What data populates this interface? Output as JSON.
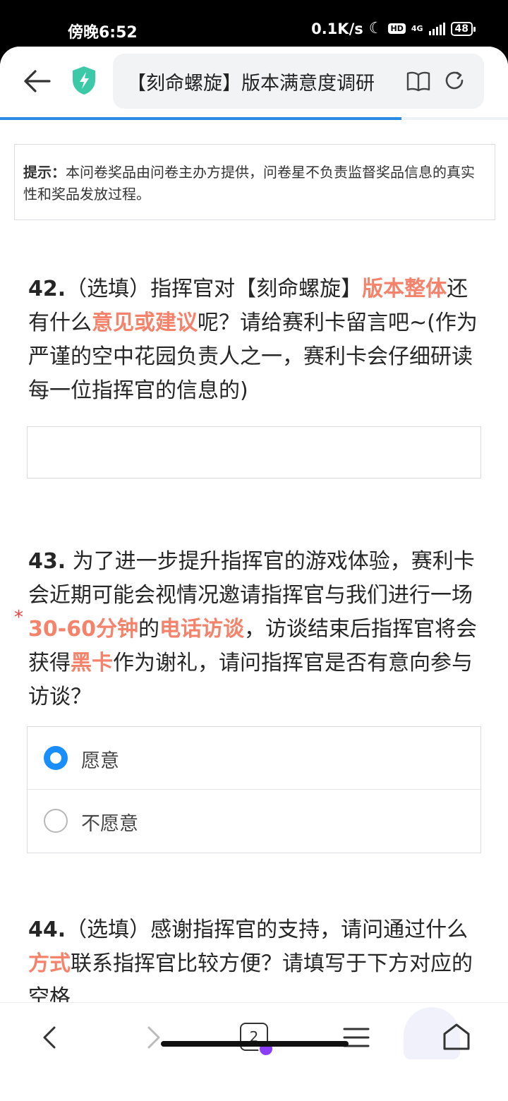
{
  "status_bar": {
    "time": "傍晚6:52",
    "net_speed": "0.1K/s",
    "hd": "HD",
    "network": "4G",
    "battery": "48"
  },
  "browser": {
    "page_title": "【刻命螺旋】版本满意度调研",
    "load_progress_pct": 79
  },
  "notice": {
    "label": "提示：",
    "text": "本问卷奖品由问卷主办方提供，问卷星不负责监督奖品信息的真实性和奖品发放过程。"
  },
  "q42": {
    "num": "42.",
    "t1": "（选填）指挥官对【刻命螺旋】",
    "h1": "版本整体",
    "t2": "还有什么",
    "h2": "意见或建议",
    "t3": "呢？请给赛利卡留言吧~(作为严谨的空中花园负责人之一，赛利卡会仔细研读每一位指挥官的信息的)"
  },
  "q43": {
    "required_mark": "*",
    "num": "43.",
    "t1": " 为了进一步提升指挥官的游戏体验，赛利卡会近期可能会视情况邀请指挥官与我们进行一场",
    "h1": "30-60分钟",
    "t2": "的",
    "h2": "电话访谈",
    "t3": "，访谈结束后指挥官将会获得",
    "h3": "黑卡",
    "t4": "作为谢礼，请问指挥官是否有意向参与访谈？",
    "options": [
      {
        "label": "愿意",
        "selected": true
      },
      {
        "label": "不愿意",
        "selected": false
      }
    ]
  },
  "q44": {
    "num": "44.",
    "t1": "（选填）感谢指挥官的支持，请问通过什么",
    "h1": "方式",
    "t2": "联系指挥官比较方便？请填写于下方对应的空格"
  },
  "bottom_nav": {
    "tab_count": "2"
  },
  "colors": {
    "highlight": "#f5826a",
    "radio_selected": "#1a8dff",
    "progress": "#2b8be0",
    "shield": "#3cc9a8"
  }
}
